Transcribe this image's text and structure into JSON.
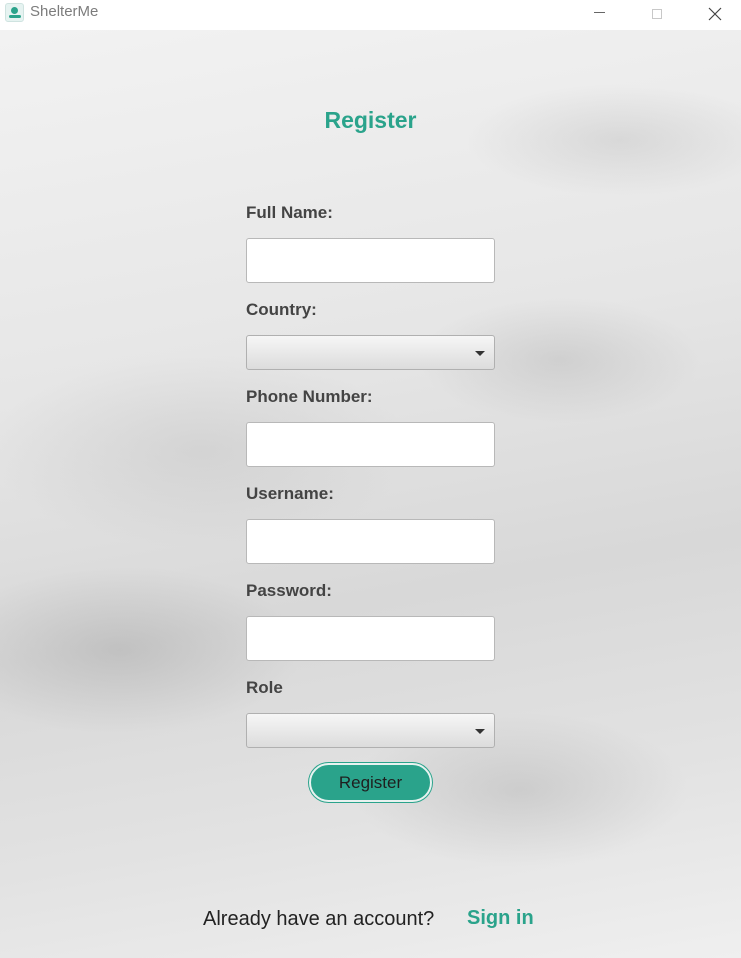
{
  "window": {
    "title": "ShelterMe",
    "icon": "shelterme-logo-icon",
    "controls": {
      "minimize": "minimize-icon",
      "maximize": "maximize-icon",
      "close": "close-icon"
    }
  },
  "form": {
    "heading": "Register",
    "full_name": {
      "label": "Full Name:",
      "value": ""
    },
    "country": {
      "label": "Country:",
      "selected": ""
    },
    "phone": {
      "label": "Phone Number:",
      "value": ""
    },
    "username": {
      "label": "Username:",
      "value": ""
    },
    "password": {
      "label": "Password:",
      "value": ""
    },
    "role": {
      "label": "Role",
      "selected": ""
    },
    "submit_label": "Register"
  },
  "footer": {
    "prompt": "Already have an account?",
    "link": "Sign in"
  },
  "colors": {
    "accent": "#2aa38b",
    "label": "#444444",
    "background": "#e4e4e4"
  }
}
